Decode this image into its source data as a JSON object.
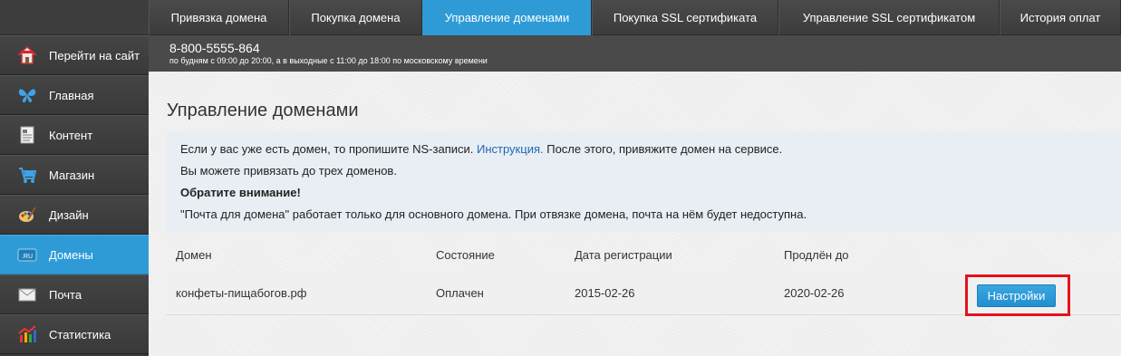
{
  "topnav": {
    "tabs": [
      {
        "label": "Привязка домена"
      },
      {
        "label": "Покупка домена"
      },
      {
        "label": "Управление доменами"
      },
      {
        "label": "Покупка SSL сертификата"
      },
      {
        "label": "Управление SSL сертификатом"
      },
      {
        "label": "История оплат"
      }
    ],
    "active_tab": "Управление доменами"
  },
  "phonebar": {
    "phone": "8-800-5555-864",
    "hours": "по будням с 09:00 до 20:00, а в выходные с 11:00 до 18:00 по московскому времени"
  },
  "sidebar": {
    "items": [
      {
        "label": "Перейти на сайт",
        "icon": "home-icon"
      },
      {
        "label": "Главная",
        "icon": "butterfly-icon"
      },
      {
        "label": "Контент",
        "icon": "document-icon"
      },
      {
        "label": "Магазин",
        "icon": "cart-icon"
      },
      {
        "label": "Дизайн",
        "icon": "palette-icon"
      },
      {
        "label": "Домены",
        "icon": "ru-domain-icon",
        "icon_text": ".RU"
      },
      {
        "label": "Почта",
        "icon": "mail-icon"
      },
      {
        "label": "Статистика",
        "icon": "chart-icon"
      }
    ],
    "active_item": "Домены"
  },
  "main": {
    "title": "Управление доменами",
    "info": {
      "line1_before": "Если у вас уже есть домен, то пропишите NS-записи. ",
      "line1_link": "Инструкция.",
      "line1_after": " После этого, привяжите домен на сервисе.",
      "line2": "Вы можете привязать до трех доменов.",
      "line3": "Обратите внимание!",
      "line4": "\"Почта для домена\" работает только для основного домена. При отвязке домена, почта на нём будет недоступна."
    },
    "table": {
      "headers": [
        "Домен",
        "Состояние",
        "Дата регистрации",
        "Продлён до"
      ],
      "rows": [
        {
          "domain": "конфеты-пищабогов.рф",
          "status": "Оплачен",
          "registered": "2015-02-26",
          "renewed_until": "2020-02-26",
          "action": "Настройки"
        }
      ]
    }
  },
  "colors": {
    "accent": "#2e9bd7",
    "highlight_frame": "#e5121c",
    "link": "#2467b5"
  }
}
